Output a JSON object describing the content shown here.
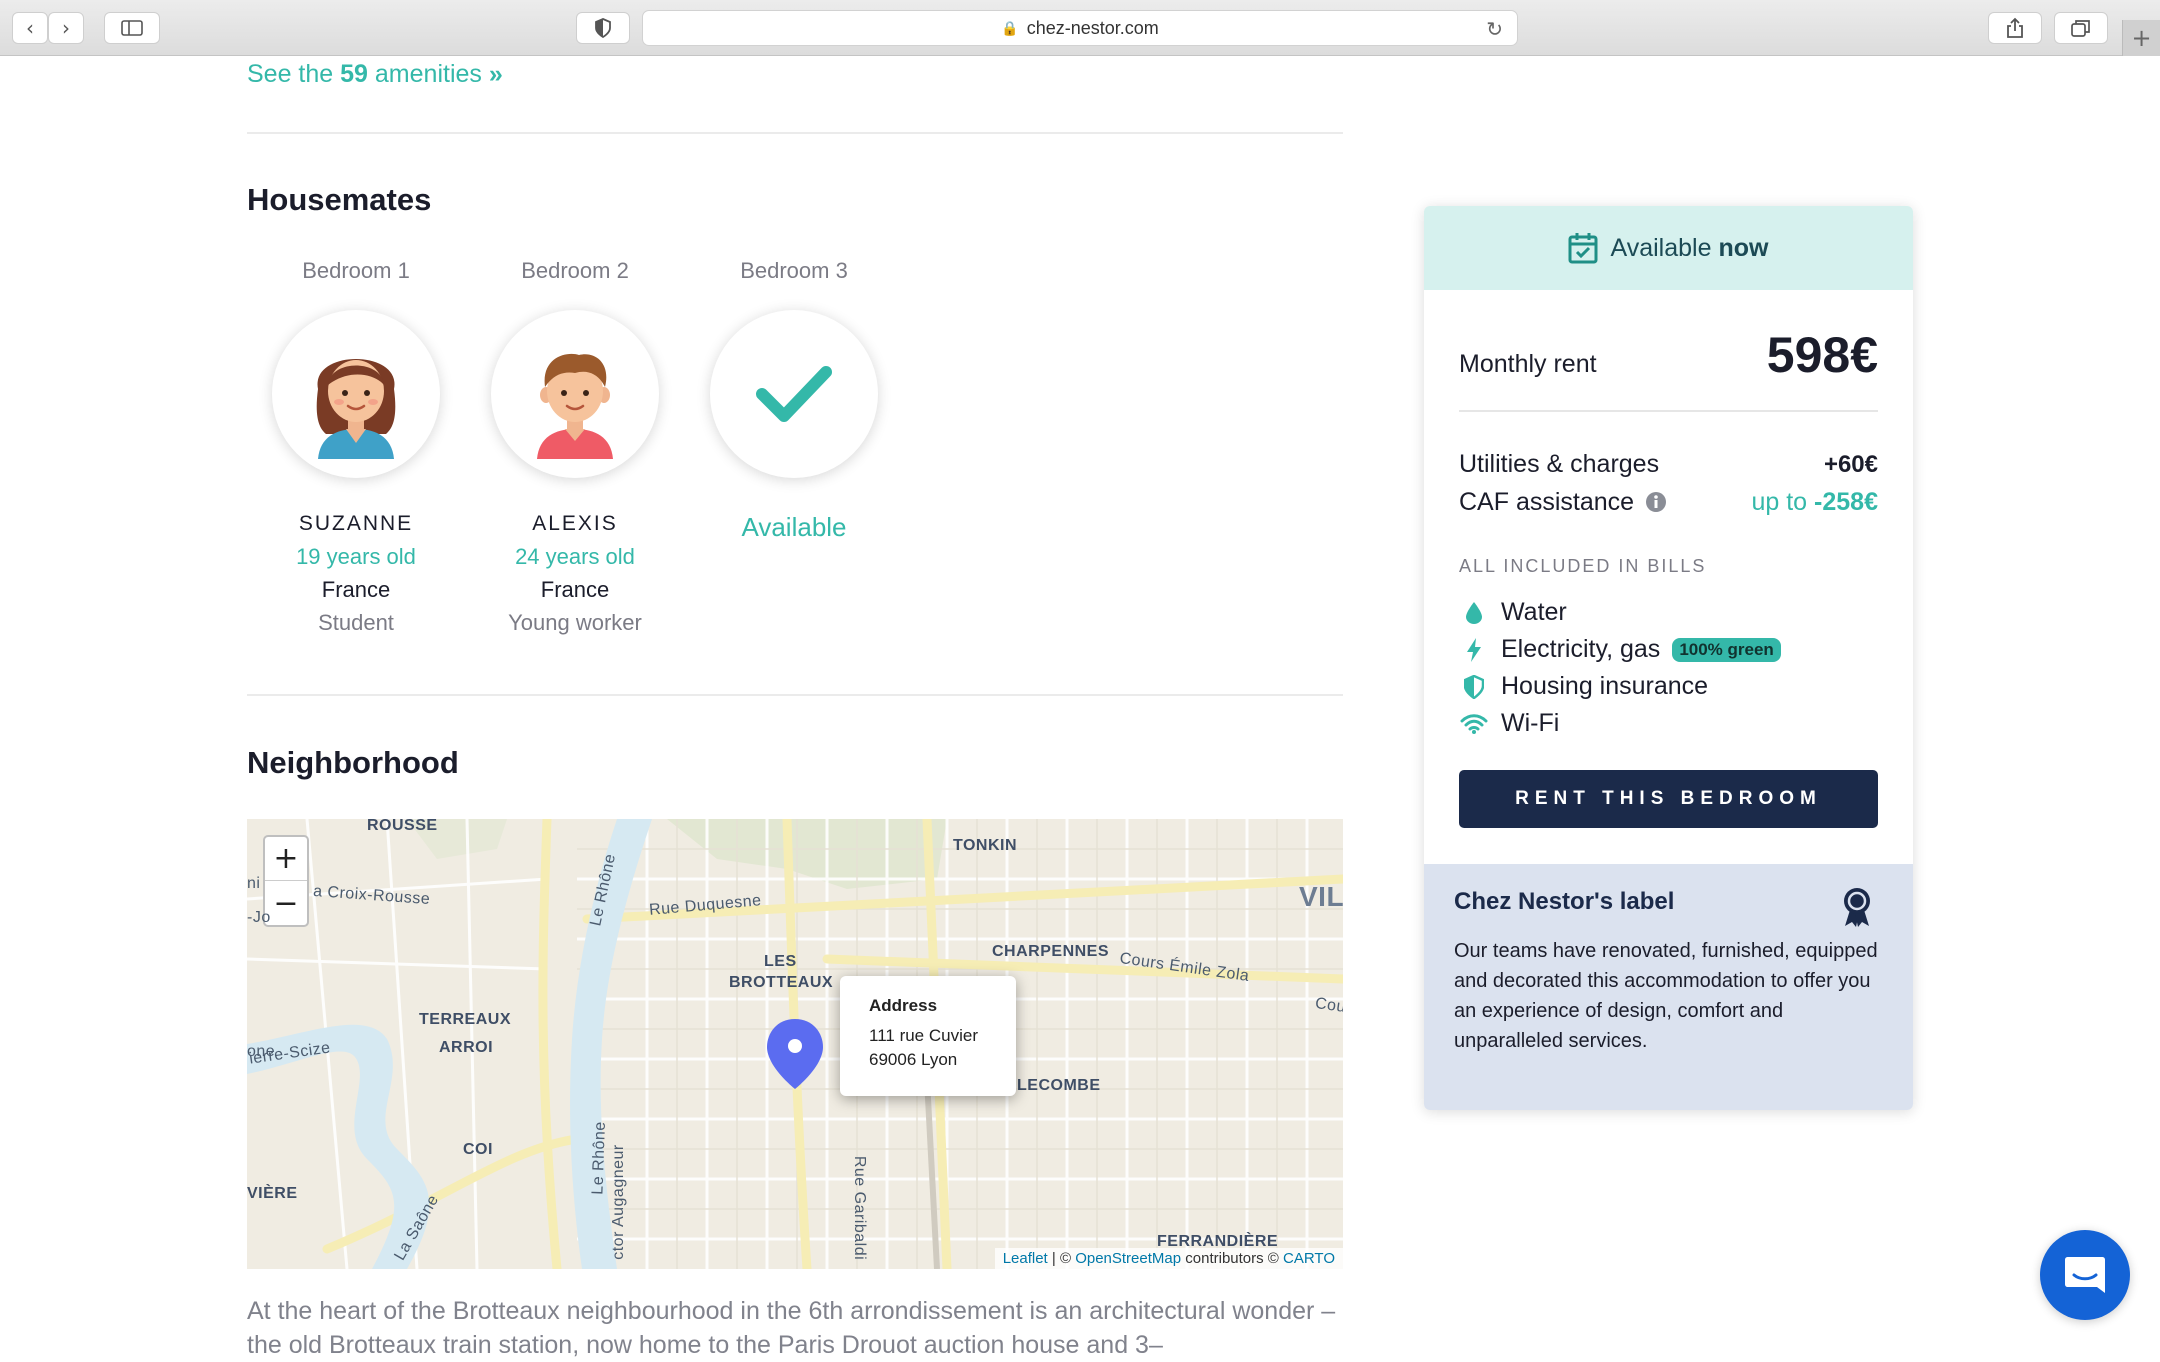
{
  "browser": {
    "url": "chez-nestor.com"
  },
  "amenities": {
    "prefix": "See the",
    "count": "59",
    "suffix": "amenities",
    "arrow": "»"
  },
  "housemates": {
    "title": "Housemates",
    "rooms": [
      {
        "room": "Bedroom 1",
        "name": "SUZANNE",
        "age": "19 years old",
        "country": "France",
        "occupation": "Student",
        "avatar": "girl-avatar"
      },
      {
        "room": "Bedroom 2",
        "name": "ALEXIS",
        "age": "24 years old",
        "country": "France",
        "occupation": "Young worker",
        "avatar": "boy-avatar"
      },
      {
        "room": "Bedroom 3",
        "status": "Available",
        "icon": "checkmark-icon"
      }
    ]
  },
  "neighborhood": {
    "title": "Neighborhood",
    "map": {
      "zoom_in": "+",
      "zoom_out": "−",
      "labels": [
        "ROUSSE",
        "TONKIN",
        "VIL",
        "a Croix-Rousse",
        "Rue Duquesne",
        "CHARPENNES",
        "Cours Émile Zola",
        "Cou",
        "LES",
        "BROTTEAUX",
        "TERREAUX",
        "ARROI",
        "ierre-Scize",
        "LECOMBE",
        "COI",
        "VIÈRE",
        "FERRANDIÈRE",
        "Rue Garibaldi",
        "ctor Augagneur",
        "Le Rhône",
        "La Saône",
        "Le Rhône",
        "ni",
        "-Jo",
        "one"
      ],
      "popup": {
        "title": "Address",
        "line1": "111 rue Cuvier",
        "line2": "69006 Lyon"
      },
      "attribution": {
        "leaflet": "Leaflet",
        "sep": " | © ",
        "osm": "OpenStreetMap",
        "contrib": " contributors © ",
        "carto": "CARTO"
      }
    },
    "description": "At the heart of the Brotteaux neighbourhood in the 6th arrondissement is an architectural wonder – the old Brotteaux train station, now home to the Paris Drouot auction house and 3–"
  },
  "card": {
    "availability_prefix": "Available",
    "availability_bold": "now",
    "monthly_rent_label": "Monthly rent",
    "monthly_rent_value": "598€",
    "utilities_label": "Utilities & charges",
    "utilities_value": "+60€",
    "caf_label": "CAF assistance",
    "caf_prefix": "up to",
    "caf_value": "-258€",
    "included_title": "ALL INCLUDED IN BILLS",
    "bills": [
      {
        "label": "Water",
        "icon": "water-drop-icon"
      },
      {
        "label": "Electricity, gas",
        "icon": "lightning-icon",
        "badge": "100% green"
      },
      {
        "label": "Housing insurance",
        "icon": "shield-icon"
      },
      {
        "label": "Wi-Fi",
        "icon": "wifi-icon"
      }
    ],
    "cta": "RENT THIS BEDROOM",
    "label_title": "Chez Nestor's label",
    "label_text": "Our teams have renovated, furnished, equipped and decorated this accommodation to offer you an experience of design, comfort and unparalleled services."
  },
  "colors": {
    "accent": "#34b8a9",
    "navy": "#1b2a4a",
    "availability_bg": "#d6f1ee",
    "label_bg": "#dbe2ef",
    "chat": "#1463d6"
  }
}
